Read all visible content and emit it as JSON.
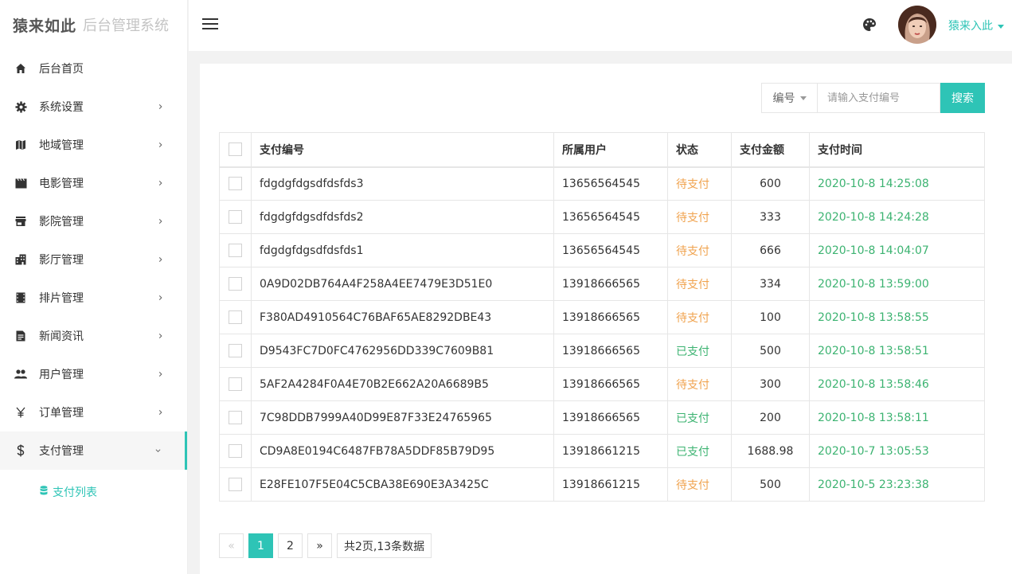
{
  "logo": {
    "brand": "猿来如此",
    "subtitle": "后台管理系统"
  },
  "header": {
    "username": "猿来入此"
  },
  "sidebar": {
    "items": [
      {
        "label": "后台首页",
        "icon": "home-icon",
        "has_arrow": false
      },
      {
        "label": "系统设置",
        "icon": "gear-icon",
        "has_arrow": true
      },
      {
        "label": "地域管理",
        "icon": "map-icon",
        "has_arrow": true
      },
      {
        "label": "电影管理",
        "icon": "movie-icon",
        "has_arrow": true
      },
      {
        "label": "影院管理",
        "icon": "store-icon",
        "has_arrow": true
      },
      {
        "label": "影厅管理",
        "icon": "building-icon",
        "has_arrow": true
      },
      {
        "label": "排片管理",
        "icon": "film-strip-icon",
        "has_arrow": true
      },
      {
        "label": "新闻资讯",
        "icon": "news-icon",
        "has_arrow": true
      },
      {
        "label": "用户管理",
        "icon": "users-icon",
        "has_arrow": true
      },
      {
        "label": "订单管理",
        "icon": "yen-icon",
        "has_arrow": true
      },
      {
        "label": "支付管理",
        "icon": "dollar-icon",
        "has_arrow": true,
        "expanded": true
      }
    ],
    "sub_items": [
      {
        "label": "支付列表",
        "icon": "database-icon"
      }
    ]
  },
  "search": {
    "select_label": "编号",
    "placeholder": "请输入支付编号",
    "button_label": "搜索"
  },
  "table": {
    "headers": [
      "支付编号",
      "所属用户",
      "状态",
      "支付金额",
      "支付时间"
    ],
    "rows": [
      {
        "id": "fdgdgfdgsdfdsfds3",
        "user": "13656564545",
        "status": "待支付",
        "paid": false,
        "amount": "600",
        "time": "2020-10-8 14:25:08"
      },
      {
        "id": "fdgdgfdgsdfdsfds2",
        "user": "13656564545",
        "status": "待支付",
        "paid": false,
        "amount": "333",
        "time": "2020-10-8 14:24:28"
      },
      {
        "id": "fdgdgfdgsdfdsfds1",
        "user": "13656564545",
        "status": "待支付",
        "paid": false,
        "amount": "666",
        "time": "2020-10-8 14:04:07"
      },
      {
        "id": "0A9D02DB764A4F258A4EE7479E3D51E0",
        "user": "13918666565",
        "status": "待支付",
        "paid": false,
        "amount": "334",
        "time": "2020-10-8 13:59:00"
      },
      {
        "id": "F380AD4910564C76BAF65AE8292DBE43",
        "user": "13918666565",
        "status": "待支付",
        "paid": false,
        "amount": "100",
        "time": "2020-10-8 13:58:55"
      },
      {
        "id": "D9543FC7D0FC4762956DD339C7609B81",
        "user": "13918666565",
        "status": "已支付",
        "paid": true,
        "amount": "500",
        "time": "2020-10-8 13:58:51"
      },
      {
        "id": "5AF2A4284F0A4E70B2E662A20A6689B5",
        "user": "13918666565",
        "status": "待支付",
        "paid": false,
        "amount": "300",
        "time": "2020-10-8 13:58:46"
      },
      {
        "id": "7C98DDB7999A40D99E87F33E24765965",
        "user": "13918666565",
        "status": "已支付",
        "paid": true,
        "amount": "200",
        "time": "2020-10-8 13:58:11"
      },
      {
        "id": "CD9A8E0194C6487FB78A5DDF85B79D95",
        "user": "13918661215",
        "status": "已支付",
        "paid": true,
        "amount": "1688.98",
        "time": "2020-10-7 13:05:53"
      },
      {
        "id": "E28FE107F5E04C5CBA38E690E3A3425C",
        "user": "13918661215",
        "status": "待支付",
        "paid": false,
        "amount": "500",
        "time": "2020-10-5 23:23:38"
      }
    ]
  },
  "pagination": {
    "prev": "«",
    "pages": [
      "1",
      "2"
    ],
    "current": "1",
    "next": "»",
    "info": "共2页,13条数据"
  },
  "colors": {
    "accent": "#2ec4b6",
    "pending": "#f0a34f",
    "paid": "#3cb371"
  }
}
